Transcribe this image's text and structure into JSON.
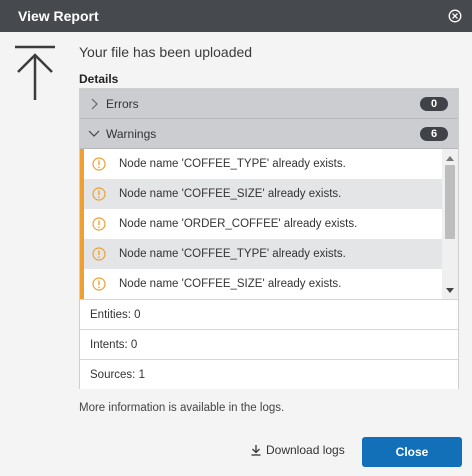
{
  "title": "View Report",
  "heading": "Your file has been uploaded",
  "details_label": "Details",
  "sections": {
    "errors": {
      "label": "Errors",
      "count": "0"
    },
    "warnings": {
      "label": "Warnings",
      "count": "6"
    }
  },
  "warnings": [
    "Node name 'COFFEE_TYPE' already exists.",
    "Node name 'COFFEE_SIZE' already exists.",
    "Node name 'ORDER_COFFEE' already exists.",
    "Node name 'COFFEE_TYPE' already exists.",
    "Node name 'COFFEE_SIZE' already exists."
  ],
  "summary": {
    "entities": "Entities: 0",
    "intents": "Intents: 0",
    "sources": "Sources: 1"
  },
  "more_info": "More information is available in the logs.",
  "buttons": {
    "download": "Download logs",
    "close": "Close"
  },
  "colors": {
    "titlebar": "#46494e",
    "warning_accent": "#f0a030",
    "primary_button": "#1170b8"
  },
  "icons": {
    "close": "close-circle-icon",
    "upload": "upload-icon",
    "warning": "warning-circle-icon",
    "download": "download-icon"
  }
}
